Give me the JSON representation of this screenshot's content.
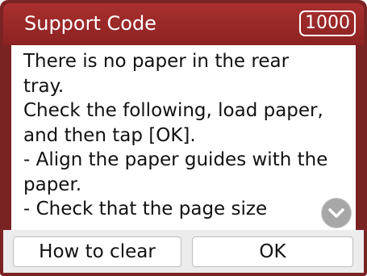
{
  "header": {
    "title": "Support Code",
    "code": "1000"
  },
  "message": {
    "text": "There is no paper in the rear\ntray.\nCheck the following, load paper,\nand then tap [OK].\n- Align the paper guides with the\npaper.\n- Check that the page size"
  },
  "icons": {
    "scroll": "chevron-down-icon"
  },
  "buttons": {
    "how_to_clear": "How to clear",
    "ok": "OK"
  }
}
